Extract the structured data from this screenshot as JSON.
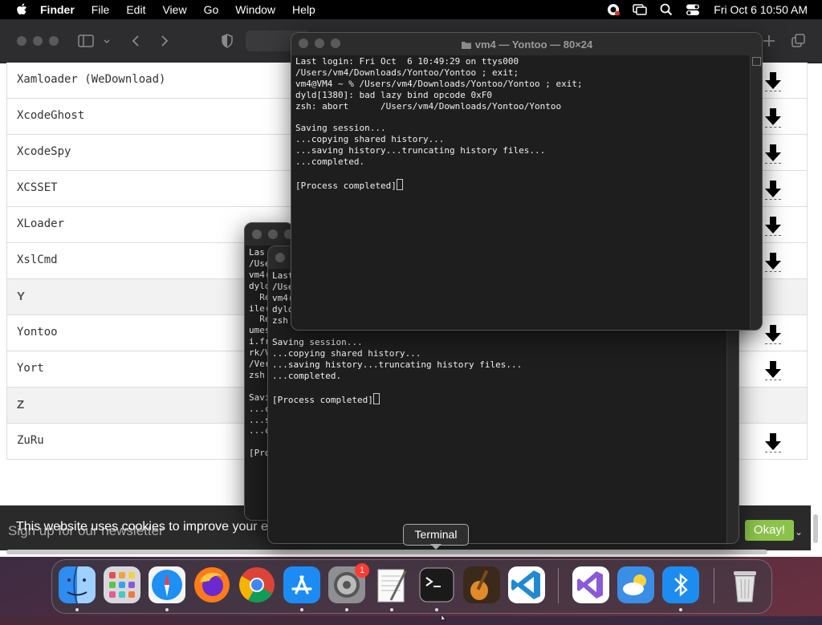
{
  "menubar": {
    "app_name": "Finder",
    "items": [
      "File",
      "Edit",
      "View",
      "Go",
      "Window",
      "Help"
    ],
    "clock": "Fri Oct 6  10:50 AM",
    "status_icons": [
      "creative-cloud-icon",
      "screen-mirroring-icon",
      "spotlight-search-icon",
      "control-center-icon"
    ]
  },
  "browser": {
    "toolbar_icons": [
      "sidebar-icon",
      "back-icon",
      "forward-icon",
      "privacy-shield-icon",
      "new-tab-icon",
      "tab-overview-icon"
    ],
    "list": [
      {
        "name": "Xamloader (WeDownload)",
        "type": "item"
      },
      {
        "name": "XcodeGhost",
        "type": "item"
      },
      {
        "name": "XcodeSpy",
        "type": "item"
      },
      {
        "name": "XCSSET",
        "type": "item"
      },
      {
        "name": "XLoader",
        "type": "item"
      },
      {
        "name": "XslCmd",
        "type": "item"
      },
      {
        "name": "Y",
        "type": "letter"
      },
      {
        "name": "Yontoo",
        "type": "item"
      },
      {
        "name": "Yort",
        "type": "item"
      },
      {
        "name": "Z",
        "type": "letter"
      },
      {
        "name": "ZuRu",
        "type": "item"
      }
    ],
    "cookie": {
      "ghost_text": "Sign up for our newsletter",
      "message": "This website uses cookies to improve your e",
      "button": "Okay!"
    }
  },
  "terminals": {
    "back": {
      "lines": [
        "Las",
        "/Use",
        "vm4(",
        "dyld",
        "  Re",
        "ile(",
        "  Re",
        "umes",
        "i.fr",
        "rk/V",
        "/Ver",
        "zsh",
        "",
        "Savi",
        "...c",
        "...s",
        "...c",
        "",
        "[Pro"
      ]
    },
    "middle": {
      "lines": [
        "Last",
        "/Use",
        "vm4(",
        "dyld",
        "zsh",
        "",
        "Saving session...",
        "...copying shared history...",
        "...saving history...truncating history files...",
        "...completed.",
        "",
        "[Process completed]"
      ]
    },
    "front": {
      "title": "vm4 — Yontoo — 80×24",
      "lines": [
        "Last login: Fri Oct  6 10:49:29 on ttys000",
        "/Users/vm4/Downloads/Yontoo/Yontoo ; exit;",
        "vm4@VM4 ~ % /Users/vm4/Downloads/Yontoo/Yontoo ; exit;",
        "dyld[1380]: bad lazy bind opcode 0xF0",
        "zsh: abort      /Users/vm4/Downloads/Yontoo/Yontoo",
        "",
        "Saving session...",
        "...copying shared history...",
        "...saving history...truncating history files...",
        "...completed.",
        "",
        "[Process completed]"
      ]
    }
  },
  "tooltip": "Terminal",
  "dock": {
    "apps": [
      {
        "name": "Finder",
        "icon": "finder-icon",
        "running": true
      },
      {
        "name": "Launchpad",
        "icon": "launchpad-icon",
        "running": false
      },
      {
        "name": "Safari",
        "icon": "safari-icon",
        "running": true
      },
      {
        "name": "Firefox",
        "icon": "firefox-icon",
        "running": false
      },
      {
        "name": "Chrome",
        "icon": "chrome-icon",
        "running": false
      },
      {
        "name": "App Store",
        "icon": "app-store-icon",
        "running": true
      },
      {
        "name": "System Settings",
        "icon": "system-settings-icon",
        "running": true,
        "badge": "1"
      },
      {
        "name": "TextEdit",
        "icon": "textedit-icon",
        "running": true
      },
      {
        "name": "Terminal",
        "icon": "terminal-icon",
        "running": true
      },
      {
        "name": "GarageBand",
        "icon": "garageband-icon",
        "running": false
      },
      {
        "name": "Visual Studio Code",
        "icon": "vscode-icon",
        "running": false
      },
      {
        "name": "Visual Studio",
        "icon": "visual-studio-icon",
        "running": false
      },
      {
        "name": "Weather",
        "icon": "weather-icon",
        "running": false
      },
      {
        "name": "Bluetooth",
        "icon": "bluetooth-icon",
        "running": true
      },
      {
        "name": "Trash",
        "icon": "trash-icon",
        "running": false
      }
    ]
  },
  "colors": {
    "accent_ok": "#8bc34a",
    "badge_red": "#ff3b30",
    "terminal_bg": "#1e1e1e"
  }
}
